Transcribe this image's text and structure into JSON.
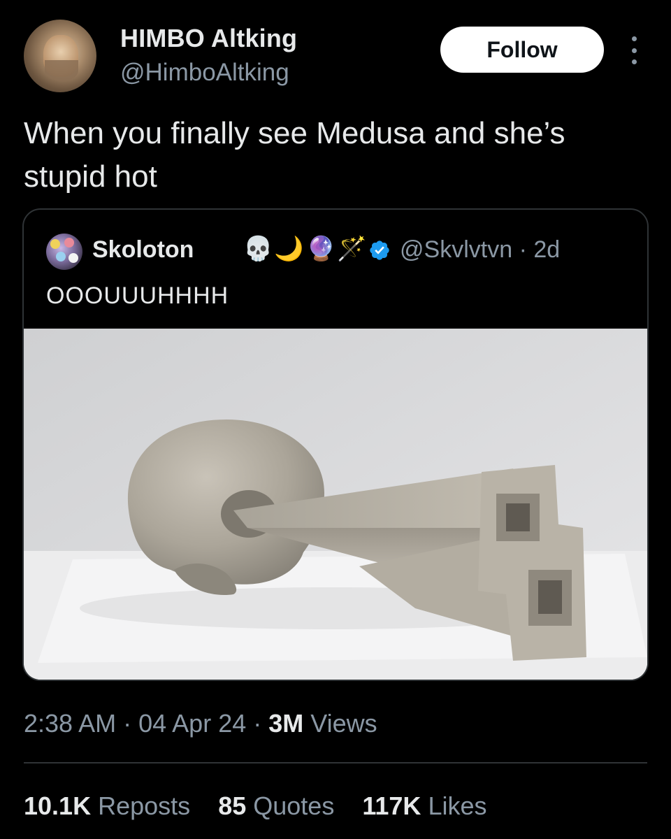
{
  "author": {
    "name": "HIMBO Altking",
    "handle": "@HimboAltking",
    "follow_label": "Follow"
  },
  "tweet": {
    "text": "When you finally see Medusa and she’s stupid hot"
  },
  "quoted_tweet": {
    "name": "Skoloton",
    "emojis": [
      "💀",
      "🌙",
      "🔮",
      "🪄"
    ],
    "verified": true,
    "handle": "@Skvlvtvn",
    "age": "2d",
    "text": "OOOUUUHHHH"
  },
  "meta": {
    "time": "2:38 AM",
    "date": "04 Apr 24",
    "views_count": "3M",
    "views_label": "Views"
  },
  "stats": {
    "reposts_count": "10.1K",
    "reposts_label": "Reposts",
    "quotes_count": "85",
    "quotes_label": "Quotes",
    "likes_count": "117K",
    "likes_label": "Likes"
  },
  "colors": {
    "background": "#000000",
    "text_primary": "#e7e9ea",
    "text_secondary": "#8b98a5",
    "border": "#2f3336",
    "verified_blue": "#1d9bf0"
  }
}
